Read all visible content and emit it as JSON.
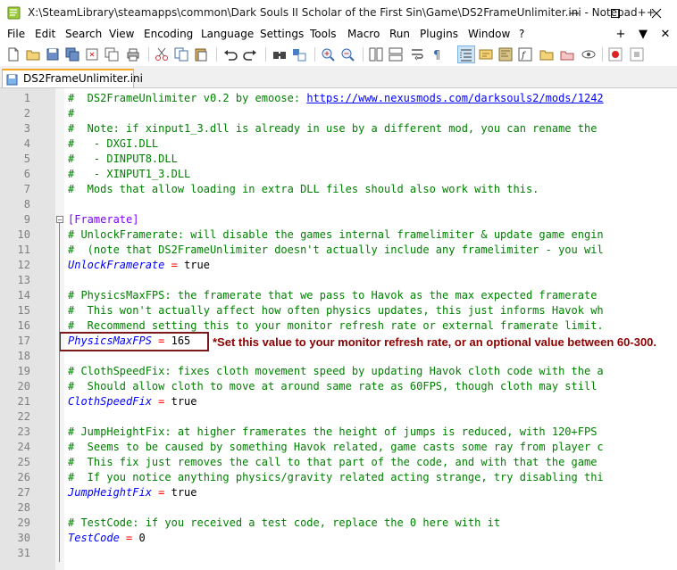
{
  "window": {
    "title": "X:\\SteamLibrary\\steamapps\\common\\Dark Souls II Scholar of the First Sin\\Game\\DS2FrameUnlimiter.ini - Notepad++"
  },
  "menu": {
    "items": [
      "File",
      "Edit",
      "Search",
      "View",
      "Encoding",
      "Language",
      "Settings",
      "Tools",
      "Macro",
      "Run",
      "Plugins",
      "Window",
      "?"
    ],
    "right_controls": [
      "+",
      "▼",
      "✕"
    ]
  },
  "tab": {
    "label": "DS2FrameUnlimiter.ini"
  },
  "editor": {
    "lines": [
      [
        {
          "t": "#  DS2FrameUnlimiter v0.2 by emoose: ",
          "c": "cmt"
        },
        {
          "t": "https://www.nexusmods.com/darksouls2/mods/1242",
          "c": "link"
        }
      ],
      [
        {
          "t": "#",
          "c": "cmt"
        }
      ],
      [
        {
          "t": "#  Note: if xinput1_3.dll is already in use by a different mod, you can rename the",
          "c": "cmt"
        }
      ],
      [
        {
          "t": "#   - DXGI.DLL",
          "c": "cmt"
        }
      ],
      [
        {
          "t": "#   - DINPUT8.DLL",
          "c": "cmt"
        }
      ],
      [
        {
          "t": "#   - XINPUT1_3.DLL",
          "c": "cmt"
        }
      ],
      [
        {
          "t": "#  Mods that allow loading in extra DLL files should also work with this.",
          "c": "cmt"
        }
      ],
      [],
      [
        {
          "t": "[Framerate]",
          "c": "section"
        }
      ],
      [
        {
          "t": "# UnlockFramerate: will disable the games internal framelimiter & update game engin",
          "c": "cmt"
        }
      ],
      [
        {
          "t": "#  (note that DS2FrameUnlimiter doesn't actually include any framelimiter - you wil",
          "c": "cmt"
        }
      ],
      [
        {
          "t": "UnlockFramerate",
          "c": "key"
        },
        {
          "t": " = ",
          "c": "eq"
        },
        {
          "t": "true",
          "c": "val"
        }
      ],
      [],
      [
        {
          "t": "# PhysicsMaxFPS: the framerate that we pass to Havok as the max expected framerate",
          "c": "cmt"
        }
      ],
      [
        {
          "t": "#  This won't actually affect how often physics updates, this just informs Havok wh",
          "c": "cmt"
        }
      ],
      [
        {
          "t": "#  Recommend setting this to your monitor refresh rate or external framerate limit.",
          "c": "cmt"
        }
      ],
      [
        {
          "t": "PhysicsMaxFPS",
          "c": "key"
        },
        {
          "t": " = ",
          "c": "eq"
        },
        {
          "t": "165",
          "c": "val"
        }
      ],
      [],
      [
        {
          "t": "# ClothSpeedFix: fixes cloth movement speed by updating Havok cloth code with the a",
          "c": "cmt"
        }
      ],
      [
        {
          "t": "#  Should allow cloth to move at around same rate as 60FPS, though cloth may still",
          "c": "cmt"
        }
      ],
      [
        {
          "t": "ClothSpeedFix",
          "c": "key"
        },
        {
          "t": " = ",
          "c": "eq"
        },
        {
          "t": "true",
          "c": "val"
        }
      ],
      [],
      [
        {
          "t": "# JumpHeightFix: at higher framerates the height of jumps is reduced, with 120+FPS",
          "c": "cmt"
        }
      ],
      [
        {
          "t": "#  Seems to be caused by something Havok related, game casts some ray from player c",
          "c": "cmt"
        }
      ],
      [
        {
          "t": "#  This fix just removes the call to that part of the code, and with that the game",
          "c": "cmt"
        }
      ],
      [
        {
          "t": "#  If you notice anything physics/gravity related acting strange, try disabling thi",
          "c": "cmt"
        }
      ],
      [
        {
          "t": "JumpHeightFix",
          "c": "key"
        },
        {
          "t": " = ",
          "c": "eq"
        },
        {
          "t": "true",
          "c": "val"
        }
      ],
      [],
      [
        {
          "t": "# TestCode: if you received a test code, replace the 0 here with it",
          "c": "cmt"
        }
      ],
      [
        {
          "t": "TestCode",
          "c": "key"
        },
        {
          "t": " = ",
          "c": "eq"
        },
        {
          "t": "0",
          "c": "val"
        }
      ],
      []
    ]
  },
  "annotation": {
    "text": "*Set this value to your monitor refresh rate, or an optional value between 60-300."
  },
  "colors": {
    "comment": "#008000",
    "link": "#0000ff",
    "section": "#8000ff",
    "key": "#0000ff",
    "operator": "#ff0000",
    "annotation": "#8b0000",
    "highlight_border": "#7a1a1a",
    "tab_accent": "#f5a623"
  },
  "icons": {
    "toolbar": [
      "new-file-icon",
      "open-file-icon",
      "save-icon",
      "save-all-icon",
      "close-icon",
      "close-all-icon",
      "print-icon",
      "cut-icon",
      "copy-icon",
      "paste-icon",
      "undo-icon",
      "redo-icon",
      "find-icon",
      "replace-icon",
      "zoom-in-icon",
      "zoom-out-icon",
      "sync-vertical-icon",
      "sync-horizontal-icon",
      "word-wrap-icon",
      "show-all-chars-icon",
      "indent-guide-icon",
      "user-defined-language-icon",
      "document-map-icon",
      "function-list-icon",
      "folder-as-workspace-icon",
      "monitoring-icon",
      "record-macro-icon",
      "stop-recording-icon"
    ]
  }
}
